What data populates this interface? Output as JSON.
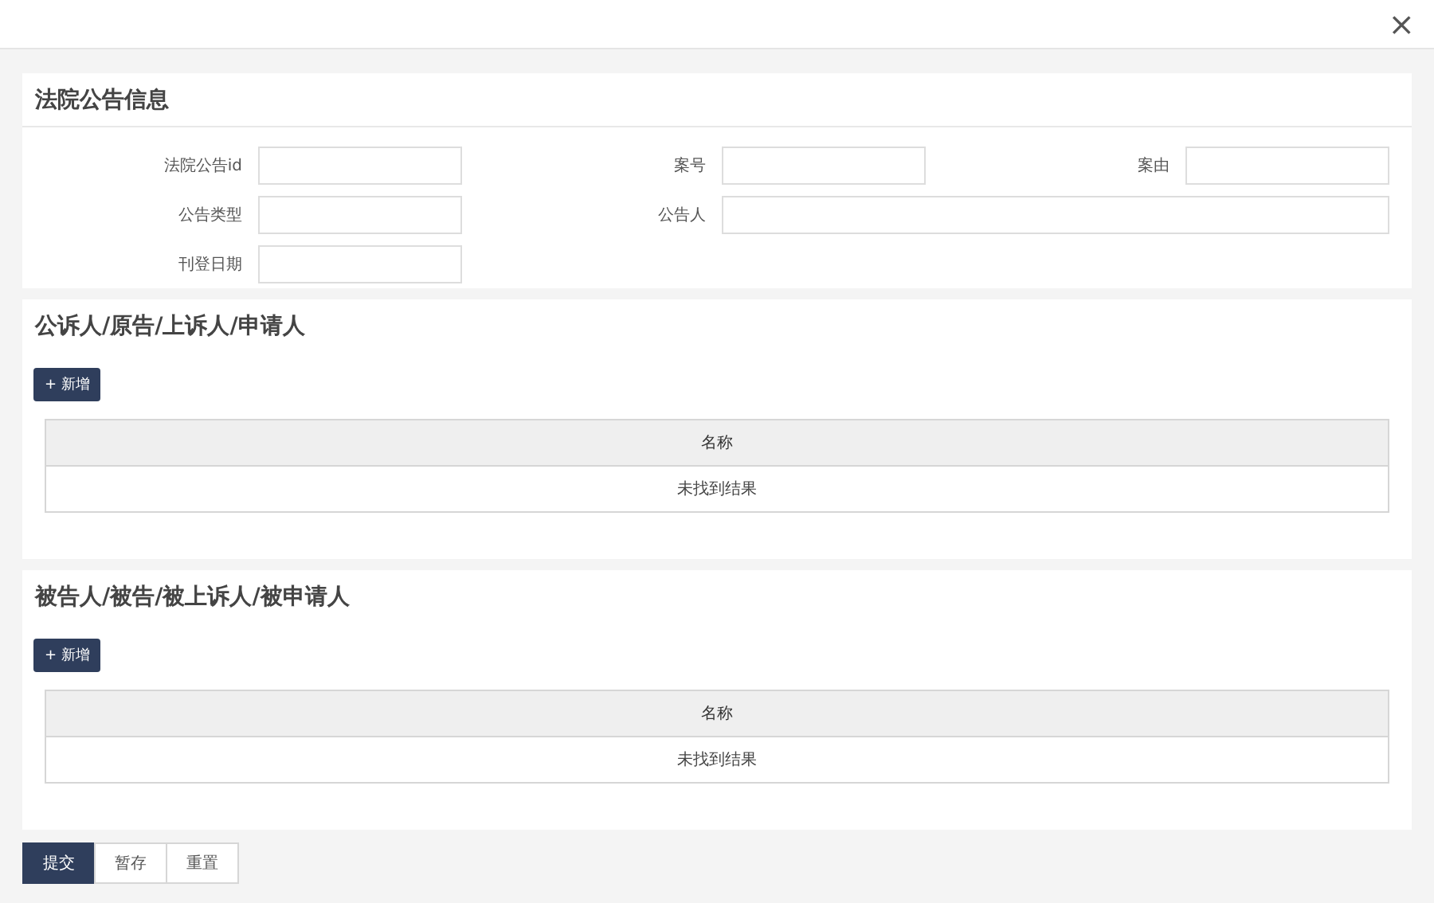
{
  "dialog": {
    "close": "×"
  },
  "info_section": {
    "title": "法院公告信息",
    "rows": [
      [
        {
          "label": "法院公告id"
        },
        {
          "label": "案号"
        },
        {
          "label": "案由"
        }
      ],
      [
        {
          "label": "公告类型"
        },
        {
          "label": "公告人",
          "wide": true
        }
      ],
      [
        {
          "label": "刊登日期"
        }
      ]
    ]
  },
  "party_sections": [
    {
      "title": "公诉人/原告/上诉人/申请人",
      "add_button": "+ 新增",
      "columns": [
        "名称"
      ],
      "empty_text": "未找到结果"
    },
    {
      "title": "被告人/被告/被上诉人/被申请人",
      "add_button": "+ 新增",
      "columns": [
        "名称"
      ],
      "empty_text": "未找到结果"
    }
  ],
  "footer_buttons": [
    {
      "label": "提交",
      "kind": "primary"
    },
    {
      "label": "暂存",
      "kind": "default"
    },
    {
      "label": "重置",
      "kind": "default"
    }
  ]
}
